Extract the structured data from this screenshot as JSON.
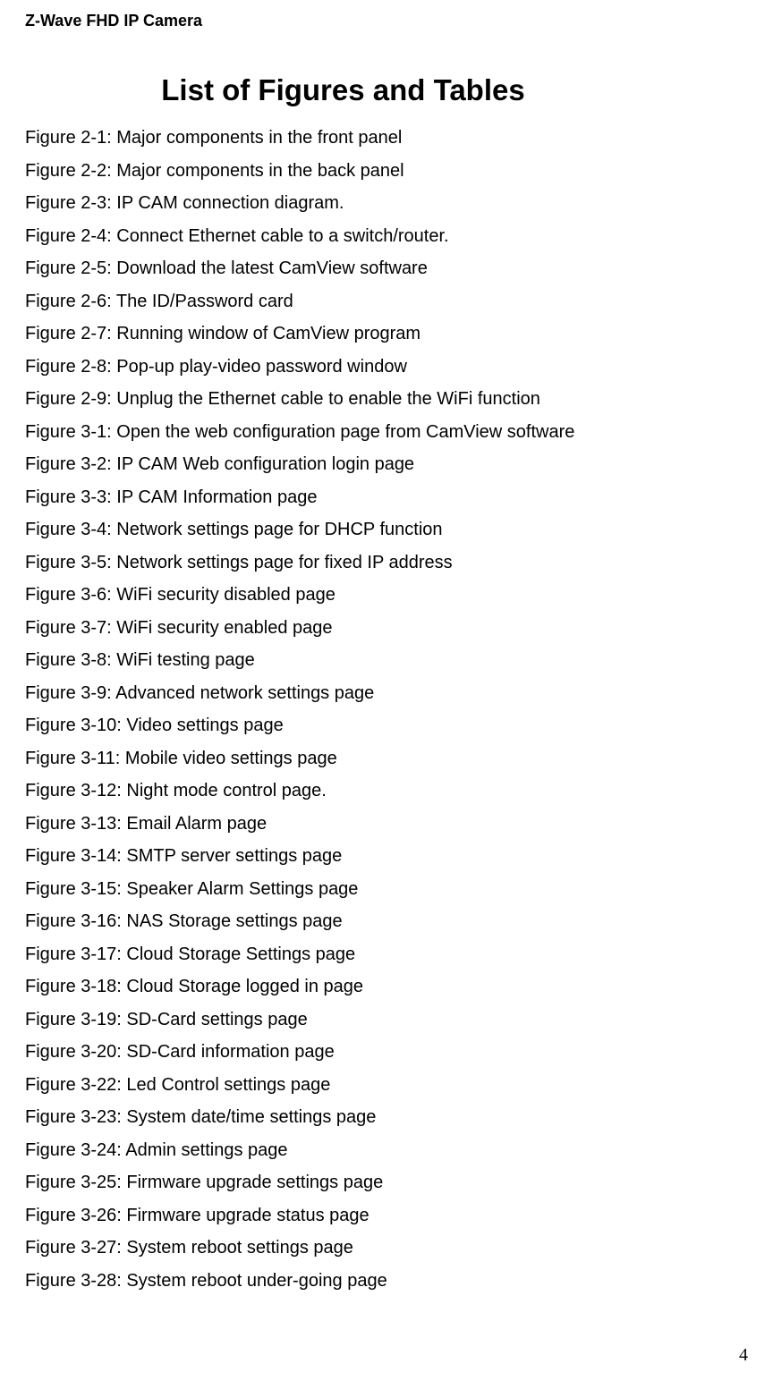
{
  "header": "Z-Wave FHD IP Camera",
  "title": "List of Figures and Tables",
  "figures": [
    "Figure 2-1: Major components in the front panel",
    "Figure 2-2: Major components in the back panel",
    "Figure 2-3: IP CAM connection diagram.",
    "Figure 2-4: Connect Ethernet cable to a switch/router.",
    "Figure 2-5: Download the latest CamView software",
    "Figure 2-6: The ID/Password card",
    "Figure 2-7: Running window of CamView program",
    "Figure 2-8: Pop-up play-video password window",
    "Figure 2-9: Unplug the Ethernet cable to enable the WiFi function",
    "Figure 3-1: Open the web configuration page from CamView software",
    "Figure 3-2: IP CAM Web configuration login page",
    "Figure 3-3: IP CAM Information page",
    "Figure 3-4: Network settings page for DHCP function",
    "Figure 3-5: Network settings page for fixed IP address",
    "Figure 3-6: WiFi security disabled page",
    "Figure 3-7: WiFi security enabled page",
    "Figure 3-8: WiFi testing page",
    "Figure 3-9: Advanced network settings page",
    "Figure 3-10: Video settings page",
    "Figure 3-11: Mobile video settings page",
    "Figure 3-12: Night mode control page.",
    "Figure 3-13: Email Alarm page",
    "Figure 3-14: SMTP server settings page",
    "Figure 3-15: Speaker Alarm Settings page",
    "Figure 3-16: NAS Storage settings page",
    "Figure 3-17: Cloud Storage Settings page",
    "Figure 3-18: Cloud Storage logged in page",
    "Figure 3-19: SD-Card settings page",
    "Figure 3-20: SD-Card information page",
    "Figure 3-22: Led Control settings page",
    "Figure 3-23: System date/time settings page",
    "Figure 3-24: Admin settings page",
    "Figure 3-25: Firmware upgrade settings page",
    "Figure 3-26: Firmware upgrade status page",
    "Figure 3-27: System reboot settings page",
    "Figure 3-28: System reboot under-going page"
  ],
  "pageNumber": "4"
}
